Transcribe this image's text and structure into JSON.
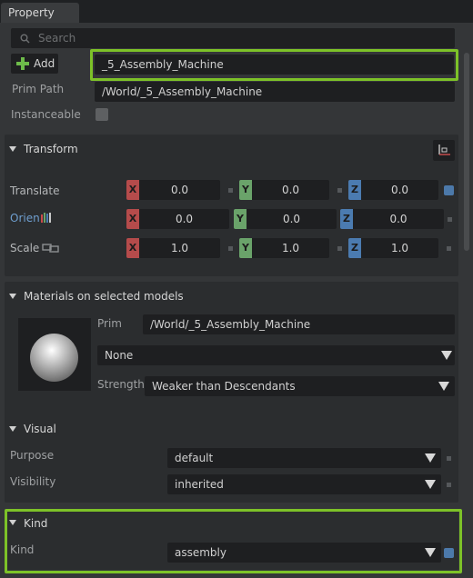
{
  "tab": {
    "label": "Property"
  },
  "search": {
    "placeholder": "Search"
  },
  "header": {
    "add_label": "Add",
    "name_value": "_5_Assembly_Machine",
    "prim_path_label": "Prim Path",
    "prim_path_value": "/World/_5_Assembly_Machine",
    "instanceable_label": "Instanceable"
  },
  "transform": {
    "title": "Transform",
    "rows": [
      {
        "label": "Translate",
        "x": "0.0",
        "y": "0.0",
        "z": "0.0"
      },
      {
        "label": "Orien",
        "x": "0.0",
        "y": "0.0",
        "z": "0.0"
      },
      {
        "label": "Scale",
        "x": "1.0",
        "y": "1.0",
        "z": "1.0"
      }
    ],
    "axis_labels": {
      "x": "X",
      "y": "Y",
      "z": "Z"
    }
  },
  "materials": {
    "title": "Materials on selected models",
    "prim_label": "Prim",
    "prim_value": "/World/_5_Assembly_Machine",
    "material_value": "None",
    "strength_label": "Strength",
    "strength_value": "Weaker than Descendants"
  },
  "visual": {
    "title": "Visual",
    "purpose_label": "Purpose",
    "purpose_value": "default",
    "visibility_label": "Visibility",
    "visibility_value": "inherited"
  },
  "kind": {
    "title": "Kind",
    "kind_label": "Kind",
    "kind_value": "assembly"
  },
  "colors": {
    "highlight": "#7dc228",
    "axis_x": "#b54b4b",
    "axis_y": "#6aa36a",
    "axis_z": "#4b7bb0",
    "accent_blue": "#4c79aa"
  },
  "icons": [
    "search-icon",
    "plus-icon",
    "checkbox",
    "transform-menu-icon",
    "orient-bars-icon",
    "scale-link-icon",
    "chevron-down-icon",
    "material-sphere"
  ]
}
